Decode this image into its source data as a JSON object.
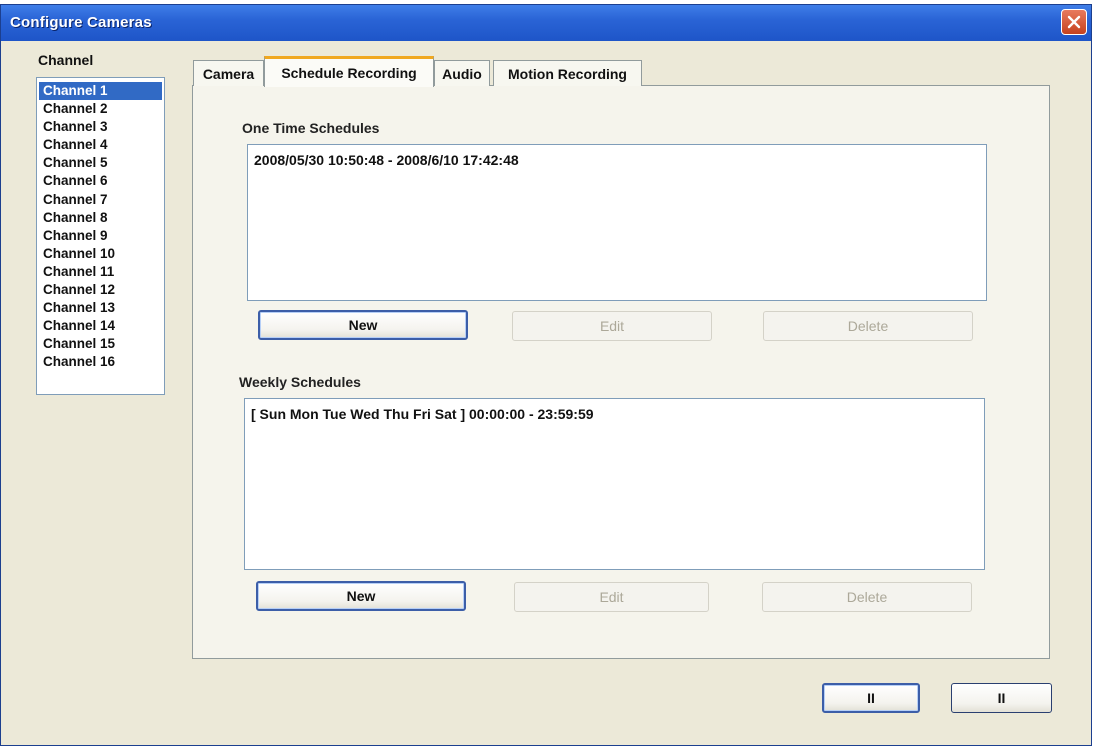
{
  "window": {
    "title": "Configure Cameras"
  },
  "channel_panel": {
    "label": "Channel",
    "items": [
      {
        "label": "Channel 1",
        "selected": true
      },
      {
        "label": "Channel 2"
      },
      {
        "label": "Channel 3"
      },
      {
        "label": "Channel 4"
      },
      {
        "label": "Channel 5"
      },
      {
        "label": "Channel 6"
      },
      {
        "label": "Channel 7"
      },
      {
        "label": "Channel 8"
      },
      {
        "label": "Channel 9"
      },
      {
        "label": "Channel 10"
      },
      {
        "label": "Channel 11"
      },
      {
        "label": "Channel 12"
      },
      {
        "label": "Channel 13"
      },
      {
        "label": "Channel 14"
      },
      {
        "label": "Channel 15"
      },
      {
        "label": "Channel 16"
      }
    ]
  },
  "tabs": [
    {
      "label": "Camera"
    },
    {
      "label": "Schedule Recording",
      "active": true
    },
    {
      "label": "Audio"
    },
    {
      "label": "Motion Recording"
    }
  ],
  "one_time": {
    "label": "One Time Schedules",
    "entries": [
      "2008/05/30 10:50:48 - 2008/6/10 17:42:48"
    ],
    "buttons": {
      "new": "New",
      "edit": "Edit",
      "delete": "Delete"
    }
  },
  "weekly": {
    "label": "Weekly Schedules",
    "entries": [
      "[ Sun Mon Tue Wed Thu Fri Sat ] 00:00:00 - 23:59:59"
    ],
    "buttons": {
      "new": "New",
      "edit": "Edit",
      "delete": "Delete"
    }
  },
  "footer": {
    "button_1": "II",
    "button_2": "II"
  },
  "colors": {
    "titlebar": "#2a64d6",
    "selection": "#316ac5",
    "tab_highlight": "#f0a820",
    "close": "#c6421f"
  },
  "icons": {
    "close": "close-icon"
  }
}
